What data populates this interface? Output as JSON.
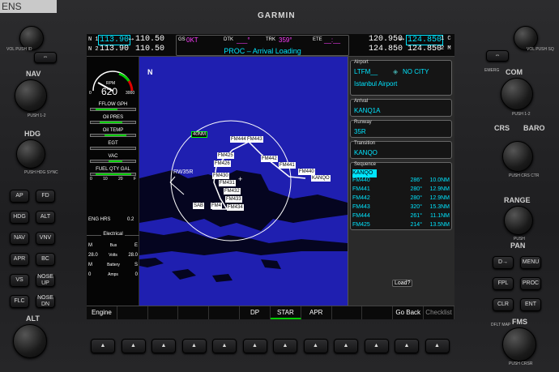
{
  "corner_text": "ENS",
  "brand": "GARMIN",
  "left_panel": {
    "vol_label": "VOL PUSH ID",
    "nav_label": "NAV",
    "nav_push": "PUSH 1-2",
    "hdg_label": "HDG",
    "hdg_push": "PUSH HDG SYNC",
    "buttons": [
      "AP",
      "FD",
      "HDG",
      "ALT",
      "NAV",
      "VNV",
      "APR",
      "BC",
      "VS",
      "NOSE UP",
      "FLC",
      "NOSE DN"
    ],
    "alt_label": "ALT"
  },
  "right_panel": {
    "vol_label": "VOL PUSH SQ",
    "emerg": "EMERG",
    "com_label": "COM",
    "com_push": "PUSH 1-2",
    "crs_label": "CRS",
    "baro_label": "BARO",
    "crs_push": "PUSH CRS CTR",
    "range_label": "RANGE",
    "pan_push": "PUSH",
    "pan_label": "PAN",
    "buttons": [
      "D→",
      "MENU",
      "FPL",
      "PROC",
      "CLR",
      "ENT"
    ],
    "fms_label": "FMS",
    "dflt_map": "DFLT MAP",
    "push_crsr": "PUSH CRSR"
  },
  "topbar": {
    "nav1_label": "N 1",
    "nav1_active": "113.90",
    "nav1_standby": "110.50",
    "nav2_label": "N 2",
    "nav2_active": "113.90",
    "nav2_standby": "110.50",
    "gs_label": "GS",
    "gs_value": "0KT",
    "dtk_label": "DTK",
    "dtk_value": "___°",
    "trk_label": "TRK",
    "trk_value": "359°",
    "ete_label": "ETE",
    "ete_value": "__:__",
    "mode": "PROC – Arrival Loading",
    "com1_standby": "120.950",
    "com1_active": "124.850",
    "com1_label": "1 C",
    "com2_standby": "124.850",
    "com2_active": "124.850",
    "com2_label": "2 M",
    "com_mid_label": "O"
  },
  "eis": {
    "rpm_label": "RPM",
    "rpm_value": "620",
    "rpm_min": "0",
    "rpm_max": "3000",
    "fflow": "FFLOW GPH",
    "oil_pres": "Oil PRES",
    "oil_temp": "Oil TEMP",
    "egt": "EGT",
    "vac": "VAC",
    "fuel": "FUEL QTY GAL",
    "fuel_ticks": [
      "0",
      "10",
      "20",
      "F"
    ],
    "eng_hrs_label": "ENG HRS",
    "eng_hrs_value": "0.2",
    "electrical": "Electrical",
    "elec_rows": [
      {
        "l": "M",
        "c": "Bus",
        "r": "E"
      },
      {
        "l": "28.0",
        "c": "Volts",
        "r": "28.0"
      },
      {
        "l": "M",
        "c": "Battery",
        "r": "S"
      },
      {
        "l": "0",
        "c": "Amps",
        "r": "0"
      }
    ]
  },
  "map": {
    "north": "N",
    "range": "40NM",
    "waypoints": [
      "FM444",
      "FM443",
      "FM425",
      "FM426",
      "FM442",
      "FM441",
      "FM440",
      "KANQO",
      "FM430",
      "FM431",
      "FM432",
      "FM433",
      "FM434",
      "SAB",
      "FM4",
      "RW35R"
    ],
    "load_label": "Load?"
  },
  "panel": {
    "airport_title": "Airport",
    "airport_code": "LTFM__",
    "airport_city": "NO CITY",
    "airport_name": "Istanbul Airport",
    "arrival_title": "Arrival",
    "arrival_value": "KANQ1A",
    "runway_title": "Runway",
    "runway_value": "35R",
    "transition_title": "Transition",
    "transition_value": "KANQO",
    "sequence_title": "Sequence",
    "sequence_head": "KANQO",
    "sequence": [
      {
        "wp": "FM440",
        "crs": "286°",
        "dist": "10.0NM"
      },
      {
        "wp": "FM441",
        "crs": "280°",
        "dist": "12.9NM"
      },
      {
        "wp": "FM442",
        "crs": "280°",
        "dist": "12.9NM"
      },
      {
        "wp": "FM443",
        "crs": "320°",
        "dist": "15.3NM"
      },
      {
        "wp": "FM444",
        "crs": "261°",
        "dist": "11.1NM"
      },
      {
        "wp": "FM425",
        "crs": "214°",
        "dist": "13.5NM"
      }
    ]
  },
  "softkeys": [
    "Engine",
    "",
    "",
    "",
    "",
    "DP",
    "STAR",
    "APR",
    "",
    "",
    "Go Back",
    "Checklist"
  ]
}
